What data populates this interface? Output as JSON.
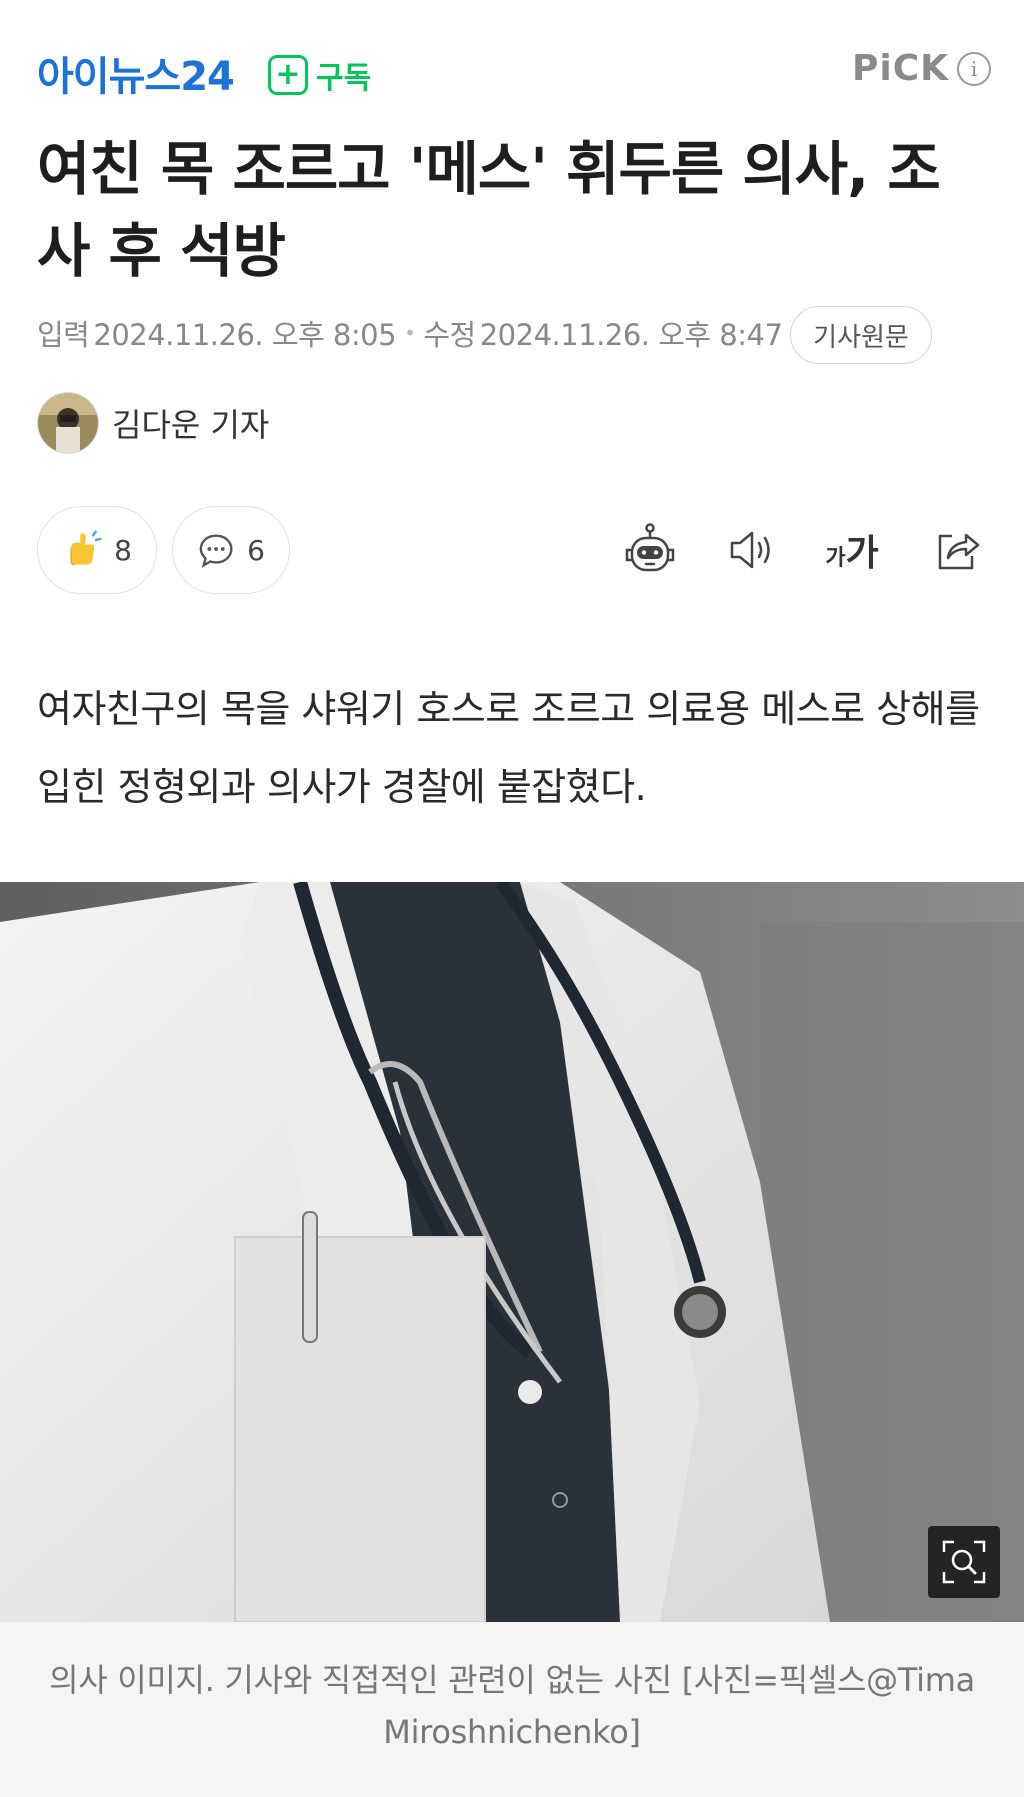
{
  "header": {
    "logo_text": "아이뉴스24",
    "subscribe_label": "구독",
    "pick_label": "PiCK",
    "info_glyph": "i"
  },
  "article": {
    "title": "여친 목 조르고 '메스' 휘두른 의사, 조사 후 석방",
    "input_label": "입력",
    "input_time": "2024.11.26. 오후 8:05",
    "edit_label": "수정",
    "edit_time": "2024.11.26. 오후 8:47",
    "origin_button": "기사원문",
    "author": "김다운 기자",
    "lead": "여자친구의 목을 샤워기 호스로 조르고 의료용 메스로 상해를 입힌 정형외과 의사가 경찰에 붙잡혔다.",
    "caption": "의사 이미지. 기사와 직접적인 관련이 없는 사진 [사진=픽셀스@Tima Miroshnichenko]"
  },
  "reactions": {
    "like_count": "8",
    "comment_count": "6"
  },
  "toolbar": {
    "font_small": "가",
    "font_big": "가"
  },
  "icons": [
    "plus-icon",
    "info-icon",
    "like-icon",
    "comment-icon",
    "robot-icon",
    "speaker-icon",
    "font-size-icon",
    "share-icon",
    "zoom-icon"
  ],
  "colors": {
    "logo": "#1a73d9",
    "subscribe": "#03c75a",
    "meta": "#888888"
  }
}
